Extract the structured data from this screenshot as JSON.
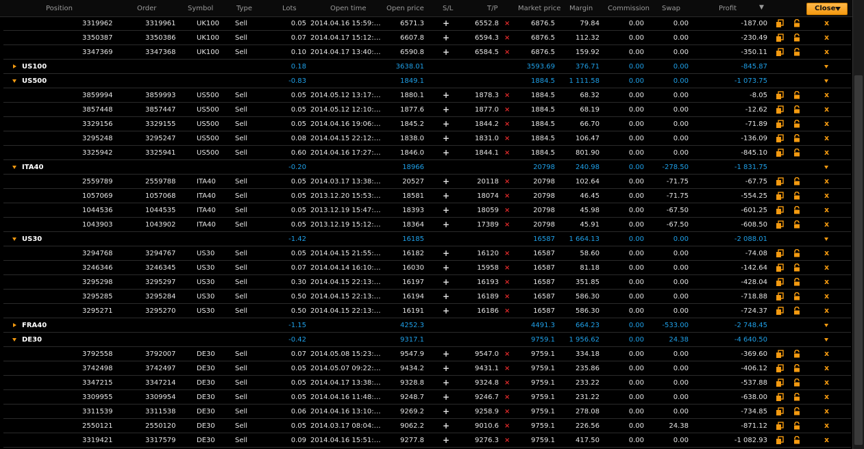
{
  "header": {
    "columns": {
      "position": "Position",
      "order": "Order",
      "symbol": "Symbol",
      "type": "Type",
      "lots": "Lots",
      "open_time": "Open time",
      "open_price": "Open price",
      "sl": "S/L",
      "tp": "T/P",
      "market_price": "Market price",
      "margin": "Margin",
      "commission": "Commission",
      "swap": "Swap",
      "profit": "Profit"
    },
    "sort_icon": "sort-descending-icon",
    "close_label": "Close"
  },
  "colors": {
    "accent": "#f49a10",
    "group_text": "#1fa0e8",
    "sl_x": "#e02a2a",
    "background": "#000000"
  },
  "rows": [
    {
      "kind": "pos",
      "position": "3319962",
      "order": "3319961",
      "symbol": "UK100",
      "type": "Sell",
      "lots": "0.05",
      "open_time": "2014.04.16 15:59:…",
      "open_price": "6571.3",
      "tp": "6552.8",
      "market_price": "6876.5",
      "margin": "79.84",
      "commission": "0.00",
      "swap": "0.00",
      "profit": "-187.00"
    },
    {
      "kind": "pos",
      "position": "3350387",
      "order": "3350386",
      "symbol": "UK100",
      "type": "Sell",
      "lots": "0.07",
      "open_time": "2014.04.17 15:12:…",
      "open_price": "6607.8",
      "tp": "6594.3",
      "market_price": "6876.5",
      "margin": "112.32",
      "commission": "0.00",
      "swap": "0.00",
      "profit": "-230.49"
    },
    {
      "kind": "pos",
      "position": "3347369",
      "order": "3347368",
      "symbol": "UK100",
      "type": "Sell",
      "lots": "0.10",
      "open_time": "2014.04.17 13:40:…",
      "open_price": "6590.8",
      "tp": "6584.5",
      "market_price": "6876.5",
      "margin": "159.92",
      "commission": "0.00",
      "swap": "0.00",
      "profit": "-350.11"
    },
    {
      "kind": "group",
      "expanded": false,
      "name": "US100",
      "lots": "0.18",
      "open_price": "3638.01",
      "market_price": "3593.69",
      "margin": "376.71",
      "commission": "0.00",
      "swap": "0.00",
      "profit": "-845.87"
    },
    {
      "kind": "group",
      "expanded": true,
      "name": "US500",
      "lots": "-0.83",
      "open_price": "1849.1",
      "market_price": "1884.5",
      "margin": "1 111.58",
      "commission": "0.00",
      "swap": "0.00",
      "profit": "-1 073.75"
    },
    {
      "kind": "pos",
      "position": "3859994",
      "order": "3859993",
      "symbol": "US500",
      "type": "Sell",
      "lots": "0.05",
      "open_time": "2014.05.12 13:17:…",
      "open_price": "1880.1",
      "tp": "1878.3",
      "market_price": "1884.5",
      "margin": "68.32",
      "commission": "0.00",
      "swap": "0.00",
      "profit": "-8.05"
    },
    {
      "kind": "pos",
      "position": "3857448",
      "order": "3857447",
      "symbol": "US500",
      "type": "Sell",
      "lots": "0.05",
      "open_time": "2014.05.12 12:10:…",
      "open_price": "1877.6",
      "tp": "1877.0",
      "market_price": "1884.5",
      "margin": "68.19",
      "commission": "0.00",
      "swap": "0.00",
      "profit": "-12.62"
    },
    {
      "kind": "pos",
      "position": "3329156",
      "order": "3329155",
      "symbol": "US500",
      "type": "Sell",
      "lots": "0.05",
      "open_time": "2014.04.16 19:06:…",
      "open_price": "1845.2",
      "tp": "1844.2",
      "market_price": "1884.5",
      "margin": "66.70",
      "commission": "0.00",
      "swap": "0.00",
      "profit": "-71.89"
    },
    {
      "kind": "pos",
      "position": "3295248",
      "order": "3295247",
      "symbol": "US500",
      "type": "Sell",
      "lots": "0.08",
      "open_time": "2014.04.15 22:12:…",
      "open_price": "1838.0",
      "tp": "1831.0",
      "market_price": "1884.5",
      "margin": "106.47",
      "commission": "0.00",
      "swap": "0.00",
      "profit": "-136.09"
    },
    {
      "kind": "pos",
      "position": "3325942",
      "order": "3325941",
      "symbol": "US500",
      "type": "Sell",
      "lots": "0.60",
      "open_time": "2014.04.16 17:27:…",
      "open_price": "1846.0",
      "tp": "1844.1",
      "market_price": "1884.5",
      "margin": "801.90",
      "commission": "0.00",
      "swap": "0.00",
      "profit": "-845.10"
    },
    {
      "kind": "group",
      "expanded": true,
      "name": "ITA40",
      "lots": "-0.20",
      "open_price": "18966",
      "market_price": "20798",
      "margin": "240.98",
      "commission": "0.00",
      "swap": "-278.50",
      "profit": "-1 831.75"
    },
    {
      "kind": "pos",
      "position": "2559789",
      "order": "2559788",
      "symbol": "ITA40",
      "type": "Sell",
      "lots": "0.05",
      "open_time": "2014.03.17 13:38:…",
      "open_price": "20527",
      "tp": "20118",
      "market_price": "20798",
      "margin": "102.64",
      "commission": "0.00",
      "swap": "-71.75",
      "profit": "-67.75"
    },
    {
      "kind": "pos",
      "position": "1057069",
      "order": "1057068",
      "symbol": "ITA40",
      "type": "Sell",
      "lots": "0.05",
      "open_time": "2013.12.20 15:53:…",
      "open_price": "18581",
      "tp": "18074",
      "market_price": "20798",
      "margin": "46.45",
      "commission": "0.00",
      "swap": "-71.75",
      "profit": "-554.25"
    },
    {
      "kind": "pos",
      "position": "1044536",
      "order": "1044535",
      "symbol": "ITA40",
      "type": "Sell",
      "lots": "0.05",
      "open_time": "2013.12.19 15:47:…",
      "open_price": "18393",
      "tp": "18059",
      "market_price": "20798",
      "margin": "45.98",
      "commission": "0.00",
      "swap": "-67.50",
      "profit": "-601.25"
    },
    {
      "kind": "pos",
      "position": "1043903",
      "order": "1043902",
      "symbol": "ITA40",
      "type": "Sell",
      "lots": "0.05",
      "open_time": "2013.12.19 15:12:…",
      "open_price": "18364",
      "tp": "17389",
      "market_price": "20798",
      "margin": "45.91",
      "commission": "0.00",
      "swap": "-67.50",
      "profit": "-608.50"
    },
    {
      "kind": "group",
      "expanded": true,
      "name": "US30",
      "lots": "-1.42",
      "open_price": "16185",
      "market_price": "16587",
      "margin": "1 664.13",
      "commission": "0.00",
      "swap": "0.00",
      "profit": "-2 088.01"
    },
    {
      "kind": "pos",
      "position": "3294768",
      "order": "3294767",
      "symbol": "US30",
      "type": "Sell",
      "lots": "0.05",
      "open_time": "2014.04.15 21:55:…",
      "open_price": "16182",
      "tp": "16120",
      "market_price": "16587",
      "margin": "58.60",
      "commission": "0.00",
      "swap": "0.00",
      "profit": "-74.08"
    },
    {
      "kind": "pos",
      "position": "3246346",
      "order": "3246345",
      "symbol": "US30",
      "type": "Sell",
      "lots": "0.07",
      "open_time": "2014.04.14 16:10:…",
      "open_price": "16030",
      "tp": "15958",
      "market_price": "16587",
      "margin": "81.18",
      "commission": "0.00",
      "swap": "0.00",
      "profit": "-142.64"
    },
    {
      "kind": "pos",
      "position": "3295298",
      "order": "3295297",
      "symbol": "US30",
      "type": "Sell",
      "lots": "0.30",
      "open_time": "2014.04.15 22:13:…",
      "open_price": "16197",
      "tp": "16193",
      "market_price": "16587",
      "margin": "351.85",
      "commission": "0.00",
      "swap": "0.00",
      "profit": "-428.04"
    },
    {
      "kind": "pos",
      "position": "3295285",
      "order": "3295284",
      "symbol": "US30",
      "type": "Sell",
      "lots": "0.50",
      "open_time": "2014.04.15 22:13:…",
      "open_price": "16194",
      "tp": "16189",
      "market_price": "16587",
      "margin": "586.30",
      "commission": "0.00",
      "swap": "0.00",
      "profit": "-718.88"
    },
    {
      "kind": "pos",
      "position": "3295271",
      "order": "3295270",
      "symbol": "US30",
      "type": "Sell",
      "lots": "0.50",
      "open_time": "2014.04.15 22:13:…",
      "open_price": "16191",
      "tp": "16186",
      "market_price": "16587",
      "margin": "586.30",
      "commission": "0.00",
      "swap": "0.00",
      "profit": "-724.37"
    },
    {
      "kind": "group",
      "expanded": false,
      "name": "FRA40",
      "lots": "-1.15",
      "open_price": "4252.3",
      "market_price": "4491.3",
      "margin": "664.23",
      "commission": "0.00",
      "swap": "-533.00",
      "profit": "-2 748.45"
    },
    {
      "kind": "group",
      "expanded": true,
      "name": "DE30",
      "lots": "-0.42",
      "open_price": "9317.1",
      "market_price": "9759.1",
      "margin": "1 956.62",
      "commission": "0.00",
      "swap": "24.38",
      "profit": "-4 640.50"
    },
    {
      "kind": "pos",
      "position": "3792558",
      "order": "3792007",
      "symbol": "DE30",
      "type": "Sell",
      "lots": "0.07",
      "open_time": "2014.05.08 15:23:…",
      "open_price": "9547.9",
      "tp": "9547.0",
      "market_price": "9759.1",
      "margin": "334.18",
      "commission": "0.00",
      "swap": "0.00",
      "profit": "-369.60"
    },
    {
      "kind": "pos",
      "position": "3742498",
      "order": "3742497",
      "symbol": "DE30",
      "type": "Sell",
      "lots": "0.05",
      "open_time": "2014.05.07 09:22:…",
      "open_price": "9434.2",
      "tp": "9431.1",
      "market_price": "9759.1",
      "margin": "235.86",
      "commission": "0.00",
      "swap": "0.00",
      "profit": "-406.12"
    },
    {
      "kind": "pos",
      "position": "3347215",
      "order": "3347214",
      "symbol": "DE30",
      "type": "Sell",
      "lots": "0.05",
      "open_time": "2014.04.17 13:38:…",
      "open_price": "9328.8",
      "tp": "9324.8",
      "market_price": "9759.1",
      "margin": "233.22",
      "commission": "0.00",
      "swap": "0.00",
      "profit": "-537.88"
    },
    {
      "kind": "pos",
      "position": "3309955",
      "order": "3309954",
      "symbol": "DE30",
      "type": "Sell",
      "lots": "0.05",
      "open_time": "2014.04.16 11:48:…",
      "open_price": "9248.7",
      "tp": "9246.7",
      "market_price": "9759.1",
      "margin": "231.22",
      "commission": "0.00",
      "swap": "0.00",
      "profit": "-638.00"
    },
    {
      "kind": "pos",
      "position": "3311539",
      "order": "3311538",
      "symbol": "DE30",
      "type": "Sell",
      "lots": "0.06",
      "open_time": "2014.04.16 13:10:…",
      "open_price": "9269.2",
      "tp": "9258.9",
      "market_price": "9759.1",
      "margin": "278.08",
      "commission": "0.00",
      "swap": "0.00",
      "profit": "-734.85"
    },
    {
      "kind": "pos",
      "position": "2550121",
      "order": "2550120",
      "symbol": "DE30",
      "type": "Sell",
      "lots": "0.05",
      "open_time": "2014.03.17 08:04:…",
      "open_price": "9062.2",
      "tp": "9010.6",
      "market_price": "9759.1",
      "margin": "226.56",
      "commission": "0.00",
      "swap": "24.38",
      "profit": "-871.12"
    },
    {
      "kind": "pos",
      "position": "3319421",
      "order": "3317579",
      "symbol": "DE30",
      "type": "Sell",
      "lots": "0.09",
      "open_time": "2014.04.16 15:51:…",
      "open_price": "9277.8",
      "tp": "9276.3",
      "market_price": "9759.1",
      "margin": "417.50",
      "commission": "0.00",
      "swap": "0.00",
      "profit": "-1 082.93"
    }
  ]
}
